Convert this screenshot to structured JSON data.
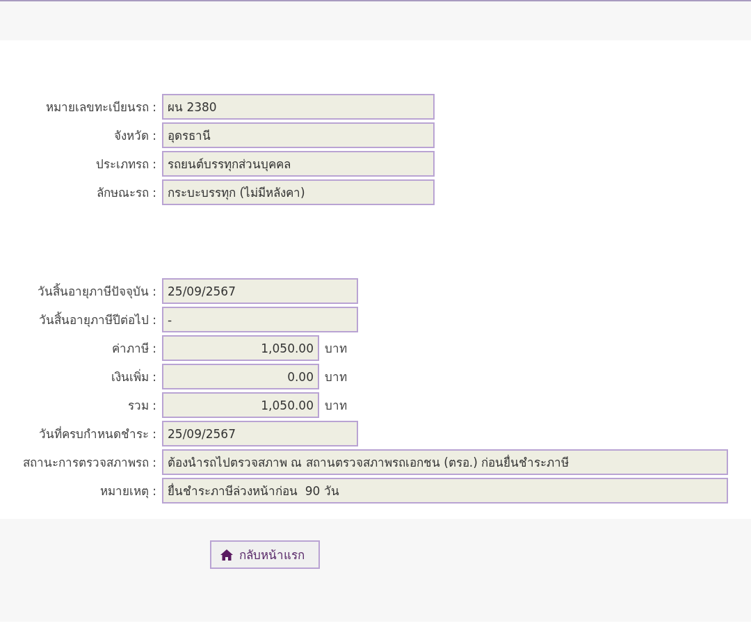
{
  "vehicle": [
    {
      "label": "หมายเลขทะเบียนรถ :",
      "value": "ผน 2380",
      "kind": "long"
    },
    {
      "label": "จังหวัด :",
      "value": "อุดรธานี",
      "kind": "long"
    },
    {
      "label": "ประเภทรถ :",
      "value": "รถยนต์บรรทุกส่วนบุคคล",
      "kind": "long"
    },
    {
      "label": "ลักษณะรถ :",
      "value": "กระบะบรรทุก (ไม่มีหลังคา)",
      "kind": "long"
    }
  ],
  "tax": [
    {
      "label": "วันสิ้นอายุภาษีปัจจุบัน :",
      "value": "25/09/2567",
      "kind": "medium"
    },
    {
      "label": "วันสิ้นอายุภาษีปีต่อไป :",
      "value": "-",
      "kind": "medium"
    },
    {
      "label": "ค่าภาษี :",
      "value": "1,050.00",
      "kind": "amount",
      "unit": "บาท"
    },
    {
      "label": "เงินเพิ่ม :",
      "value": "0.00",
      "kind": "amount",
      "unit": "บาท"
    },
    {
      "label": "รวม :",
      "value": "1,050.00",
      "kind": "amount",
      "unit": "บาท"
    },
    {
      "label": "วันที่ครบกำหนดชำระ :",
      "value": "25/09/2567",
      "kind": "medium"
    },
    {
      "label": "สถานะการตรวจสภาพรถ :",
      "value": "ต้องนำรถไปตรวจสภาพ ณ สถานตรวจสภาพรถเอกชน (ตรอ.) ก่อนยื่นชำระภาษี",
      "kind": "full"
    },
    {
      "label": "หมายเหตุ :",
      "value": "ยื่นชำระภาษีล่วงหน้าก่อน  90 วัน",
      "kind": "full"
    }
  ],
  "home_button": {
    "label": "กลับหน้าแรก"
  }
}
